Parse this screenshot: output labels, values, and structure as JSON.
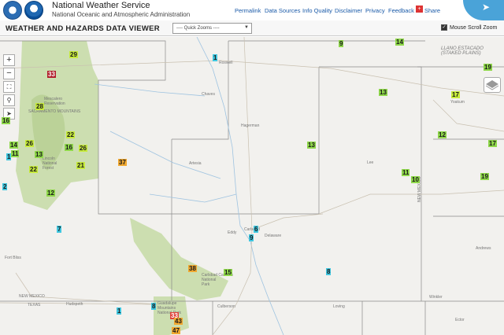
{
  "header": {
    "title": "National Weather Service",
    "subtitle": "National Oceanic and Atmospheric Administration",
    "nav": [
      "Permalink",
      "Data Sources",
      "Info Quality",
      "Disclaimer",
      "Privacy",
      "Feedback"
    ],
    "share_label": "Share"
  },
  "toolbar": {
    "viewer_title": "WEATHER AND HAZARDS DATA VIEWER",
    "quick_zooms": "---- Quick Zooms ----",
    "mouse_scroll": "Mouse Scroll Zoom"
  },
  "controls": {
    "zoom_in": "+",
    "zoom_out": "−"
  },
  "map_labels": {
    "roswell": "Roswell",
    "chaves": "Chaves",
    "lee": "Lee",
    "eddy": "Eddy",
    "carlsbad": "Carlsbad",
    "mescalero": "Mescalero\nReservation",
    "sacramento": "SACRAMENTO MOUNTAINS",
    "lincoln": "Lincoln\nNational\nForest",
    "llano": "LLANO ESTACADO\n(STAKED PLAINS)",
    "yoakum": "Yoakum",
    "andrews": "Andrews",
    "texas": "TEXAS",
    "new_mexico": "NEW MEXICO",
    "new_mexico_v": "NEW MEXICO",
    "hudspeth": "Hudspeth",
    "culberson": "Culberson",
    "guadalupe": "Guadalupe\nMountains\nNational Park",
    "carlsbad_caverns": "Carlsbad Caverns\nNational\nPark",
    "loving": "Loving",
    "winkler": "Winkler",
    "ector": "Ector",
    "fort_bliss": "Fort Bliss",
    "delaware": "Delaware",
    "artesia": "Artesia",
    "hagerman": "Hagerman"
  },
  "points": [
    {
      "v": "29",
      "c": "c-yg"
    },
    {
      "v": "33",
      "c": "c-dr"
    },
    {
      "v": "1",
      "c": "c-cy"
    },
    {
      "v": "9",
      "c": "c-lg"
    },
    {
      "v": "14",
      "c": "c-lg"
    },
    {
      "v": "19",
      "c": "c-lg"
    },
    {
      "v": "13",
      "c": "c-lg"
    },
    {
      "v": "17",
      "c": "c-yg"
    },
    {
      "v": "28",
      "c": "c-yg"
    },
    {
      "v": "16",
      "c": "c-lg"
    },
    {
      "v": "22",
      "c": "c-yg"
    },
    {
      "v": "14",
      "c": "c-lg"
    },
    {
      "v": "26",
      "c": "c-yg"
    },
    {
      "v": "11",
      "c": "c-lg"
    },
    {
      "v": "13",
      "c": "c-lg"
    },
    {
      "v": "16",
      "c": "c-lg"
    },
    {
      "v": "26",
      "c": "c-yg"
    },
    {
      "v": "1",
      "c": "c-cy"
    },
    {
      "v": "22",
      "c": "c-yg"
    },
    {
      "v": "21",
      "c": "c-yg"
    },
    {
      "v": "37",
      "c": "c-or"
    },
    {
      "v": "2",
      "c": "c-cy"
    },
    {
      "v": "12",
      "c": "c-lg"
    },
    {
      "v": "13",
      "c": "c-lg"
    },
    {
      "v": "12",
      "c": "c-lg"
    },
    {
      "v": "17",
      "c": "c-lg"
    },
    {
      "v": "19",
      "c": "c-lg"
    },
    {
      "v": "11",
      "c": "c-lg"
    },
    {
      "v": "10",
      "c": "c-lg"
    },
    {
      "v": "7",
      "c": "c-cy"
    },
    {
      "v": "6",
      "c": "c-cy"
    },
    {
      "v": "9",
      "c": "c-cy"
    },
    {
      "v": "38",
      "c": "c-or"
    },
    {
      "v": "15",
      "c": "c-lg"
    },
    {
      "v": "8",
      "c": "c-cy"
    },
    {
      "v": "1",
      "c": "c-cy"
    },
    {
      "v": "8",
      "c": "c-cy"
    },
    {
      "v": "33",
      "c": "c-rd"
    },
    {
      "v": "43",
      "c": "c-or"
    },
    {
      "v": "47",
      "c": "c-or"
    }
  ]
}
